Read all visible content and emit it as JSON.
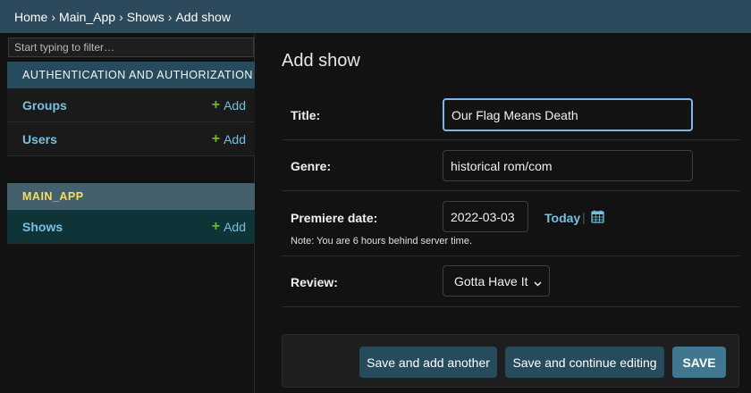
{
  "breadcrumb": {
    "home": "Home",
    "app": "Main_App",
    "model": "Shows",
    "current": "Add show",
    "separator": "›"
  },
  "sidebar": {
    "filter_placeholder": "Start typing to filter…",
    "apps": [
      {
        "header": "AUTHENTICATION AND AUTHORIZATION",
        "models": [
          {
            "name": "Groups",
            "add": "Add"
          },
          {
            "name": "Users",
            "add": "Add"
          }
        ]
      },
      {
        "header": "MAIN_APP",
        "models": [
          {
            "name": "Shows",
            "add": "Add"
          }
        ]
      }
    ],
    "add_symbol": "+"
  },
  "form": {
    "title": "Add show",
    "fields": {
      "title": {
        "label": "Title:",
        "value": "Our Flag Means Death"
      },
      "genre": {
        "label": "Genre:",
        "value": "historical rom/com"
      },
      "premiere_date": {
        "label": "Premiere date:",
        "value": "2022-03-03",
        "today": "Today",
        "separator": "|",
        "help": "Note: You are 6 hours behind server time."
      },
      "review": {
        "label": "Review:",
        "value": "Gotta Have It"
      }
    }
  },
  "actions": {
    "save_add_another": "Save and add another",
    "save_continue": "Save and continue editing",
    "save": "SAVE"
  },
  "icons": {
    "calendar": "calendar-icon",
    "chevron": "chevron-down-icon"
  },
  "colors": {
    "header_bg": "#2c4a5b",
    "link": "#79c0e0",
    "add_green": "#6fb92c",
    "current_app": "#f5dd5d",
    "primary_button": "#417690",
    "secondary_button": "#264b5d"
  }
}
